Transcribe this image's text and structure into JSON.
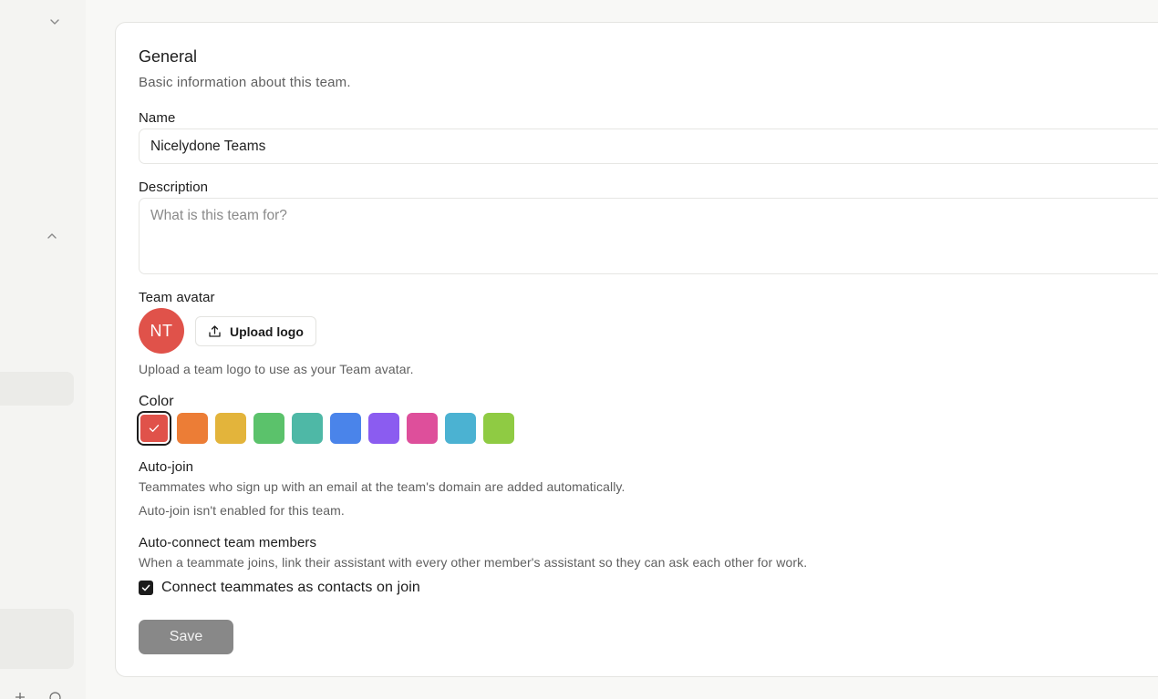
{
  "general": {
    "title": "General",
    "subtitle": "Basic information about this team."
  },
  "name_field": {
    "label": "Name",
    "value": "Nicelydone Teams"
  },
  "description_field": {
    "label": "Description",
    "placeholder": "What is this team for?",
    "value": ""
  },
  "team_avatar": {
    "label": "Team avatar",
    "initials": "NT",
    "avatar_color": "#e0524a",
    "upload_label": "Upload logo",
    "upload_icon": "upload-icon",
    "help": "Upload a team logo to use as your Team avatar."
  },
  "color": {
    "label": "Color",
    "selected_index": 0,
    "swatches": [
      "#e0524a",
      "#ec7d36",
      "#e3b43b",
      "#5bc26b",
      "#4eb8a6",
      "#4a84ea",
      "#8b5cf0",
      "#de4f9b",
      "#4bb2d2",
      "#8fcb43"
    ]
  },
  "auto_join": {
    "title": "Auto-join",
    "description": "Teammates who sign up with an email at the team's domain are added automatically.",
    "status": "Auto-join isn't enabled for this team."
  },
  "auto_connect": {
    "title": "Auto-connect team members",
    "description": "When a teammate joins, link their assistant with every other member's assistant so they can ask each other for work.",
    "checkbox_label": "Connect teammates as contacts on join",
    "checked": true
  },
  "save": {
    "label": "Save",
    "color": "#888888"
  }
}
